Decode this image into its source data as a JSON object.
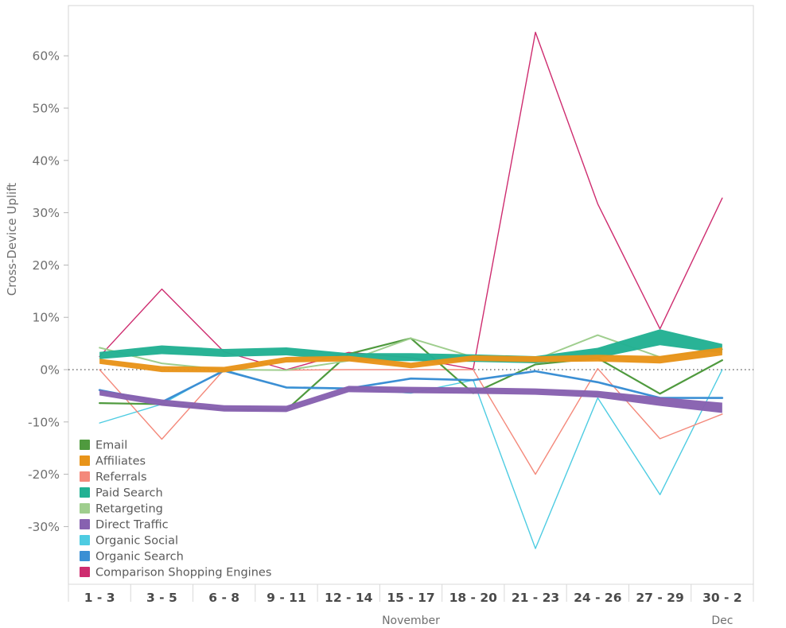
{
  "chart_data": {
    "type": "line",
    "title": "",
    "xlabel": "November",
    "ylabel": "Cross-Device Uplift",
    "categories": [
      "1 - 3",
      "3 - 5",
      "6 - 8",
      "9 - 11",
      "12 - 14",
      "15 - 17",
      "18 - 20",
      "21 - 23",
      "24 - 26",
      "27 - 29",
      "30 - 2"
    ],
    "month_labels": [
      {
        "text": "November",
        "at_category": "15 - 17"
      },
      {
        "text": "Dec",
        "at_category": "30 - 2"
      }
    ],
    "ytick_labels": [
      "60%",
      "50%",
      "40%",
      "30%",
      "20%",
      "10%",
      "0%",
      "-10%",
      "-20%",
      "-30%"
    ],
    "ytick_values": [
      60,
      50,
      40,
      30,
      20,
      10,
      0,
      -10,
      -20,
      -30
    ],
    "ylim": [
      -37,
      68
    ],
    "grid": false,
    "zero_reference_line": true,
    "legend_position": "bottom-left",
    "value_unit": "percent",
    "series": [
      {
        "name": "Email",
        "color": "#4F9A3E",
        "width": 2.2,
        "values": [
          -6.4,
          -6.6,
          -7.6,
          -7.7,
          3.0,
          6.0,
          -4.5,
          1.0,
          2.2,
          -4.6,
          1.8
        ]
      },
      {
        "name": "Affiliates",
        "color": "#E8941A",
        "width": 7.0,
        "weights": [
          6.5,
          7.5,
          7.0,
          7.0,
          7.0,
          7.0,
          7.0,
          7.5,
          8.5,
          9.5,
          10.0
        ],
        "values": [
          1.6,
          0.1,
          0.0,
          1.9,
          2.1,
          0.8,
          2.2,
          2.0,
          2.2,
          1.9,
          3.5
        ]
      },
      {
        "name": "Referrals",
        "color": "#F4897B",
        "width": 1.4,
        "values": [
          0.0,
          -13.3,
          0.0,
          -0.1,
          0.0,
          0.0,
          0.0,
          -20.0,
          0.2,
          -13.2,
          -8.5
        ]
      },
      {
        "name": "Paid Search",
        "color": "#22B193",
        "width": 11.0,
        "weights": [
          9.0,
          11.0,
          10.0,
          10.0,
          10.0,
          10.0,
          9.5,
          9.0,
          13.0,
          20.0,
          12.0
        ],
        "values": [
          2.7,
          3.8,
          3.2,
          3.5,
          2.4,
          2.4,
          2.2,
          1.9,
          3.2,
          6.2,
          4.0
        ]
      },
      {
        "name": "Retargeting",
        "color": "#9FCE8E",
        "width": 2.0,
        "values": [
          4.2,
          1.2,
          0.0,
          -0.1,
          1.7,
          6.0,
          2.4,
          1.9,
          6.6,
          2.4,
          3.9
        ]
      },
      {
        "name": "Direct Traffic",
        "color": "#8761B0",
        "width": 8.0,
        "weights": [
          7.0,
          8.0,
          8.0,
          8.0,
          8.0,
          8.0,
          8.0,
          8.0,
          8.5,
          11.0,
          13.0
        ],
        "values": [
          -4.4,
          -6.3,
          -7.4,
          -7.5,
          -3.7,
          -3.9,
          -4.0,
          -4.2,
          -4.7,
          -6.1,
          -7.3
        ]
      },
      {
        "name": "Organic Social",
        "color": "#4ECCE2",
        "width": 1.4,
        "values": [
          -10.2,
          -6.6,
          0.0,
          -3.5,
          -3.7,
          -4.5,
          -2.0,
          -34.2,
          -5.4,
          -23.9,
          0.0
        ]
      },
      {
        "name": "Organic Search",
        "color": "#3B8FD4",
        "width": 2.6,
        "values": [
          -3.9,
          -6.2,
          -0.2,
          -3.4,
          -3.6,
          -1.7,
          -2.0,
          -0.3,
          -2.4,
          -5.4,
          -5.4
        ]
      },
      {
        "name": "Comparison Shopping Engines",
        "color": "#CE2C6F",
        "width": 1.4,
        "values": [
          2.5,
          15.4,
          3.4,
          0.0,
          3.3,
          2.3,
          0.1,
          64.5,
          31.7,
          7.8,
          32.8
        ]
      }
    ]
  },
  "legend": {
    "items": [
      {
        "label": "Email",
        "color": "#4F9A3E"
      },
      {
        "label": "Affiliates",
        "color": "#E8941A"
      },
      {
        "label": "Referrals",
        "color": "#F4897B"
      },
      {
        "label": "Paid Search",
        "color": "#22B193"
      },
      {
        "label": "Retargeting",
        "color": "#9FCE8E"
      },
      {
        "label": "Direct Traffic",
        "color": "#8761B0"
      },
      {
        "label": "Organic Social",
        "color": "#4ECCE2"
      },
      {
        "label": "Organic Search",
        "color": "#3B8FD4"
      },
      {
        "label": "Comparison Shopping Engines",
        "color": "#CE2C6F"
      }
    ]
  },
  "axes": {
    "y_title": "Cross-Device Uplift",
    "x_title": "November",
    "x_title_secondary": "Dec"
  },
  "colors": {
    "plot_border": "#d6d6d6",
    "tick_text": "#6f6f6f",
    "xtick_text": "#4a4a4a",
    "zero_line": "#333333",
    "background": "#ffffff"
  }
}
